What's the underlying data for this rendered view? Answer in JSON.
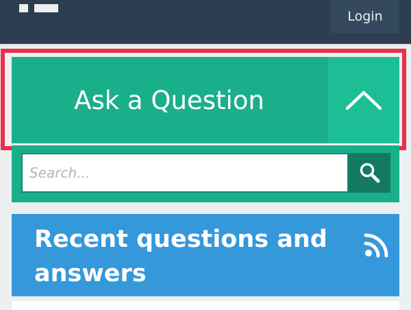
{
  "header": {
    "login_label": "Login"
  },
  "ask": {
    "label": "Ask a Question",
    "toggle_icon": "chevron-up-icon"
  },
  "search": {
    "placeholder": "Search...",
    "value": "",
    "button_icon": "search-icon"
  },
  "recent": {
    "title": "Recent questions and answers",
    "feed_icon": "rss-icon"
  },
  "colors": {
    "topbar": "#2c3e50",
    "login_button": "#34495e",
    "accent_green": "#1aaf8b",
    "search_button": "#137a61",
    "recent_blue": "#3498db",
    "highlight_red": "#e8314a"
  }
}
